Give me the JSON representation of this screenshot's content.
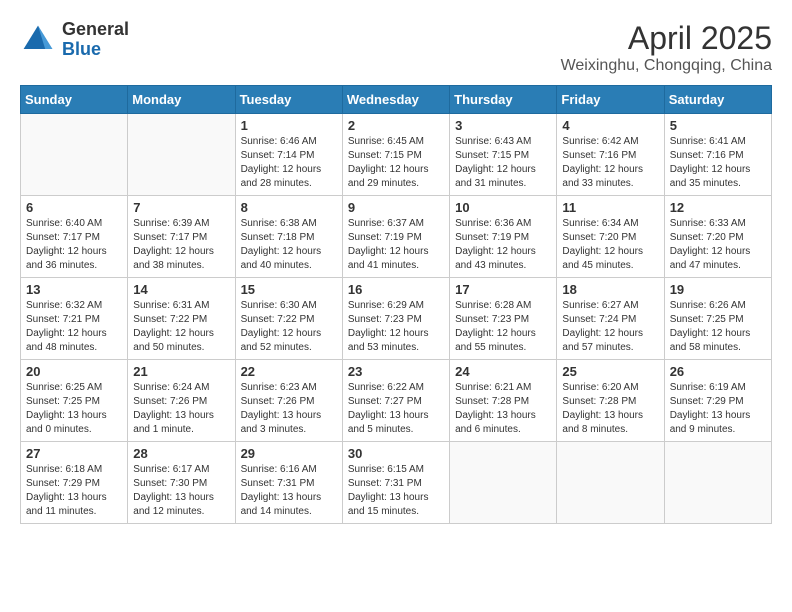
{
  "header": {
    "logo_general": "General",
    "logo_blue": "Blue",
    "month_title": "April 2025",
    "subtitle": "Weixinghu, Chongqing, China"
  },
  "days_of_week": [
    "Sunday",
    "Monday",
    "Tuesday",
    "Wednesday",
    "Thursday",
    "Friday",
    "Saturday"
  ],
  "weeks": [
    [
      {
        "day": "",
        "sunrise": "",
        "sunset": "",
        "daylight": ""
      },
      {
        "day": "",
        "sunrise": "",
        "sunset": "",
        "daylight": ""
      },
      {
        "day": "1",
        "sunrise": "Sunrise: 6:46 AM",
        "sunset": "Sunset: 7:14 PM",
        "daylight": "Daylight: 12 hours and 28 minutes."
      },
      {
        "day": "2",
        "sunrise": "Sunrise: 6:45 AM",
        "sunset": "Sunset: 7:15 PM",
        "daylight": "Daylight: 12 hours and 29 minutes."
      },
      {
        "day": "3",
        "sunrise": "Sunrise: 6:43 AM",
        "sunset": "Sunset: 7:15 PM",
        "daylight": "Daylight: 12 hours and 31 minutes."
      },
      {
        "day": "4",
        "sunrise": "Sunrise: 6:42 AM",
        "sunset": "Sunset: 7:16 PM",
        "daylight": "Daylight: 12 hours and 33 minutes."
      },
      {
        "day": "5",
        "sunrise": "Sunrise: 6:41 AM",
        "sunset": "Sunset: 7:16 PM",
        "daylight": "Daylight: 12 hours and 35 minutes."
      }
    ],
    [
      {
        "day": "6",
        "sunrise": "Sunrise: 6:40 AM",
        "sunset": "Sunset: 7:17 PM",
        "daylight": "Daylight: 12 hours and 36 minutes."
      },
      {
        "day": "7",
        "sunrise": "Sunrise: 6:39 AM",
        "sunset": "Sunset: 7:17 PM",
        "daylight": "Daylight: 12 hours and 38 minutes."
      },
      {
        "day": "8",
        "sunrise": "Sunrise: 6:38 AM",
        "sunset": "Sunset: 7:18 PM",
        "daylight": "Daylight: 12 hours and 40 minutes."
      },
      {
        "day": "9",
        "sunrise": "Sunrise: 6:37 AM",
        "sunset": "Sunset: 7:19 PM",
        "daylight": "Daylight: 12 hours and 41 minutes."
      },
      {
        "day": "10",
        "sunrise": "Sunrise: 6:36 AM",
        "sunset": "Sunset: 7:19 PM",
        "daylight": "Daylight: 12 hours and 43 minutes."
      },
      {
        "day": "11",
        "sunrise": "Sunrise: 6:34 AM",
        "sunset": "Sunset: 7:20 PM",
        "daylight": "Daylight: 12 hours and 45 minutes."
      },
      {
        "day": "12",
        "sunrise": "Sunrise: 6:33 AM",
        "sunset": "Sunset: 7:20 PM",
        "daylight": "Daylight: 12 hours and 47 minutes."
      }
    ],
    [
      {
        "day": "13",
        "sunrise": "Sunrise: 6:32 AM",
        "sunset": "Sunset: 7:21 PM",
        "daylight": "Daylight: 12 hours and 48 minutes."
      },
      {
        "day": "14",
        "sunrise": "Sunrise: 6:31 AM",
        "sunset": "Sunset: 7:22 PM",
        "daylight": "Daylight: 12 hours and 50 minutes."
      },
      {
        "day": "15",
        "sunrise": "Sunrise: 6:30 AM",
        "sunset": "Sunset: 7:22 PM",
        "daylight": "Daylight: 12 hours and 52 minutes."
      },
      {
        "day": "16",
        "sunrise": "Sunrise: 6:29 AM",
        "sunset": "Sunset: 7:23 PM",
        "daylight": "Daylight: 12 hours and 53 minutes."
      },
      {
        "day": "17",
        "sunrise": "Sunrise: 6:28 AM",
        "sunset": "Sunset: 7:23 PM",
        "daylight": "Daylight: 12 hours and 55 minutes."
      },
      {
        "day": "18",
        "sunrise": "Sunrise: 6:27 AM",
        "sunset": "Sunset: 7:24 PM",
        "daylight": "Daylight: 12 hours and 57 minutes."
      },
      {
        "day": "19",
        "sunrise": "Sunrise: 6:26 AM",
        "sunset": "Sunset: 7:25 PM",
        "daylight": "Daylight: 12 hours and 58 minutes."
      }
    ],
    [
      {
        "day": "20",
        "sunrise": "Sunrise: 6:25 AM",
        "sunset": "Sunset: 7:25 PM",
        "daylight": "Daylight: 13 hours and 0 minutes."
      },
      {
        "day": "21",
        "sunrise": "Sunrise: 6:24 AM",
        "sunset": "Sunset: 7:26 PM",
        "daylight": "Daylight: 13 hours and 1 minute."
      },
      {
        "day": "22",
        "sunrise": "Sunrise: 6:23 AM",
        "sunset": "Sunset: 7:26 PM",
        "daylight": "Daylight: 13 hours and 3 minutes."
      },
      {
        "day": "23",
        "sunrise": "Sunrise: 6:22 AM",
        "sunset": "Sunset: 7:27 PM",
        "daylight": "Daylight: 13 hours and 5 minutes."
      },
      {
        "day": "24",
        "sunrise": "Sunrise: 6:21 AM",
        "sunset": "Sunset: 7:28 PM",
        "daylight": "Daylight: 13 hours and 6 minutes."
      },
      {
        "day": "25",
        "sunrise": "Sunrise: 6:20 AM",
        "sunset": "Sunset: 7:28 PM",
        "daylight": "Daylight: 13 hours and 8 minutes."
      },
      {
        "day": "26",
        "sunrise": "Sunrise: 6:19 AM",
        "sunset": "Sunset: 7:29 PM",
        "daylight": "Daylight: 13 hours and 9 minutes."
      }
    ],
    [
      {
        "day": "27",
        "sunrise": "Sunrise: 6:18 AM",
        "sunset": "Sunset: 7:29 PM",
        "daylight": "Daylight: 13 hours and 11 minutes."
      },
      {
        "day": "28",
        "sunrise": "Sunrise: 6:17 AM",
        "sunset": "Sunset: 7:30 PM",
        "daylight": "Daylight: 13 hours and 12 minutes."
      },
      {
        "day": "29",
        "sunrise": "Sunrise: 6:16 AM",
        "sunset": "Sunset: 7:31 PM",
        "daylight": "Daylight: 13 hours and 14 minutes."
      },
      {
        "day": "30",
        "sunrise": "Sunrise: 6:15 AM",
        "sunset": "Sunset: 7:31 PM",
        "daylight": "Daylight: 13 hours and 15 minutes."
      },
      {
        "day": "",
        "sunrise": "",
        "sunset": "",
        "daylight": ""
      },
      {
        "day": "",
        "sunrise": "",
        "sunset": "",
        "daylight": ""
      },
      {
        "day": "",
        "sunrise": "",
        "sunset": "",
        "daylight": ""
      }
    ]
  ]
}
